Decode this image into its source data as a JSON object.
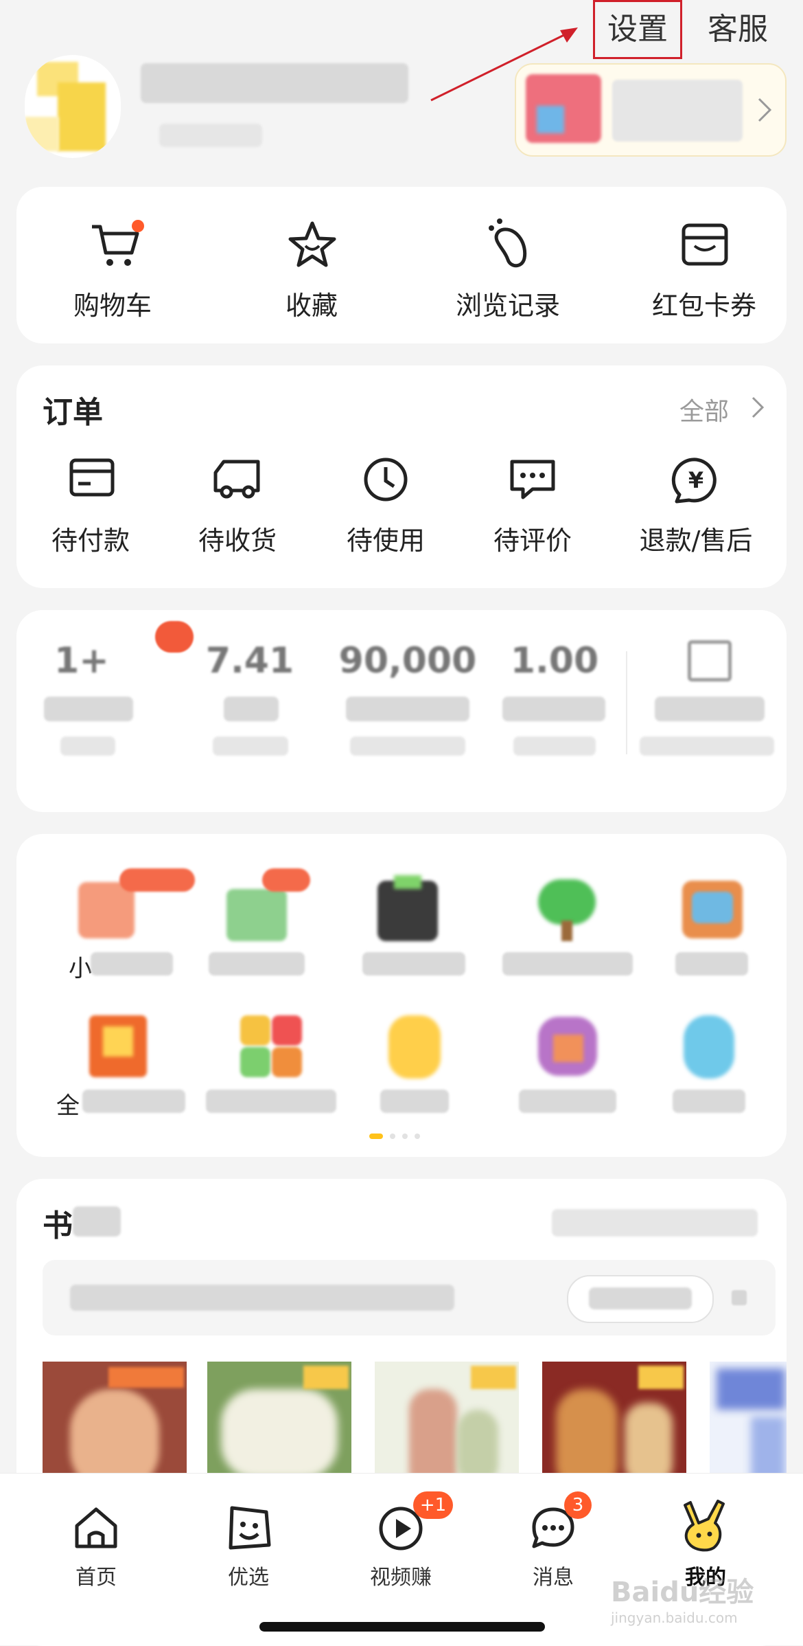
{
  "header": {
    "settings_label": "设置",
    "service_label": "客服"
  },
  "quick_actions": [
    {
      "label": "购物车",
      "icon": "cart-icon"
    },
    {
      "label": "收藏",
      "icon": "star-icon"
    },
    {
      "label": "浏览记录",
      "icon": "footprint-icon"
    },
    {
      "label": "红包卡券",
      "icon": "wallet-icon"
    }
  ],
  "orders": {
    "title": "订单",
    "all_label": "全部",
    "items": [
      {
        "label": "待付款",
        "icon": "card-icon"
      },
      {
        "label": "待收货",
        "icon": "truck-icon"
      },
      {
        "label": "待使用",
        "icon": "clock-icon"
      },
      {
        "label": "待评价",
        "icon": "comment-icon"
      },
      {
        "label": "退款/售后",
        "icon": "refund-icon"
      }
    ]
  },
  "stats": {
    "items": [
      {
        "value": "1+"
      },
      {
        "value": "7.41"
      },
      {
        "value": "90,000"
      },
      {
        "value": "1.00"
      }
    ]
  },
  "services": {
    "visible_prefixes": [
      "小",
      "全"
    ]
  },
  "bookshelf": {
    "title_prefix": "书"
  },
  "bottom_nav": [
    {
      "label": "首页",
      "icon": "home-icon"
    },
    {
      "label": "优选",
      "icon": "smile-bag-icon"
    },
    {
      "label": "视频赚",
      "icon": "play-icon",
      "badge": "+1"
    },
    {
      "label": "消息",
      "icon": "chat-icon",
      "badge": "3"
    },
    {
      "label": "我的",
      "icon": "rabbit-icon"
    }
  ],
  "watermark": {
    "line1": "Baidu经验",
    "line2": "jingyan.baidu.com"
  },
  "colors": {
    "accent": "#ff5a2a",
    "highlight_box": "#d0202a",
    "indicator": "#ffc21a"
  }
}
